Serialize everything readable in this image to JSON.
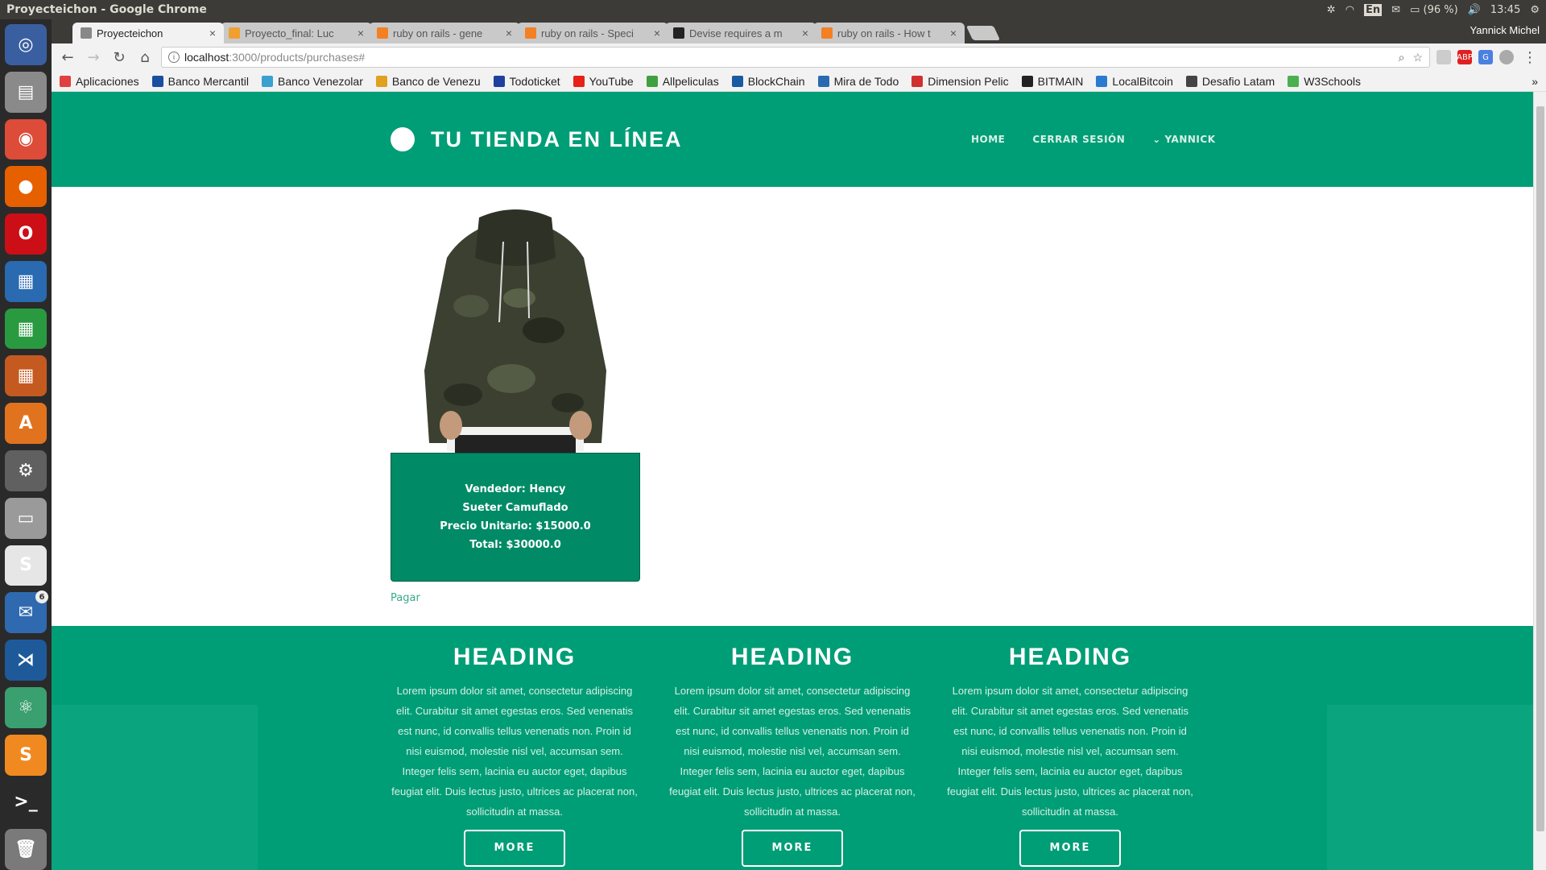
{
  "os": {
    "window_title": "Proyecteichon - Google Chrome",
    "battery": "(96 %)",
    "time": "13:45",
    "keyboard": "En"
  },
  "browser": {
    "profile": "Yannick Michel",
    "tabs": [
      {
        "label": "Proyecteichon",
        "color": "#888888"
      },
      {
        "label": "Proyecto_final: Luc",
        "color": "#f0a030"
      },
      {
        "label": "ruby on rails - gene",
        "color": "#f48024"
      },
      {
        "label": "ruby on rails - Speci",
        "color": "#f48024"
      },
      {
        "label": "Devise requires a m",
        "color": "#222222"
      },
      {
        "label": "ruby on rails - How t",
        "color": "#f48024"
      }
    ],
    "url_host": "localhost",
    "url_path": ":3000/products/purchases#",
    "bookmarks": [
      {
        "label": "Aplicaciones",
        "color": "#e04040"
      },
      {
        "label": "Banco Mercantil",
        "color": "#1a4fa0"
      },
      {
        "label": "Banco Venezolar",
        "color": "#3aa0d0"
      },
      {
        "label": "Banco de Venezu",
        "color": "#e0a020"
      },
      {
        "label": "Todoticket",
        "color": "#2040a0"
      },
      {
        "label": "YouTube",
        "color": "#e62117"
      },
      {
        "label": "Allpeliculas",
        "color": "#40a040"
      },
      {
        "label": "BlockChain",
        "color": "#1a5aa0"
      },
      {
        "label": "Mira de Todo",
        "color": "#2a6ab0"
      },
      {
        "label": "Dimension Pelic",
        "color": "#d03030"
      },
      {
        "label": "BITMAIN",
        "color": "#222222"
      },
      {
        "label": "LocalBitcoin",
        "color": "#2a7ad0"
      },
      {
        "label": "Desafio Latam",
        "color": "#444444"
      },
      {
        "label": "W3Schools",
        "color": "#4caf50"
      }
    ]
  },
  "site": {
    "brand": "TU TIENDA EN LÍNEA",
    "nav": {
      "home": "HOME",
      "logout": "CERRAR SESIÓN",
      "user": "⌄ YANNICK"
    },
    "product": {
      "seller": "Vendedor: Hency",
      "name": "Sueter Camuflado",
      "unit_price": "Precio Unitario: $15000.0",
      "total": "Total: $30000.0"
    },
    "pay_link": "Pagar",
    "features": [
      {
        "heading": "HEADING",
        "text": "Lorem ipsum dolor sit amet, consectetur adipiscing elit. Curabitur sit amet egestas eros. Sed venenatis est nunc, id convallis tellus venenatis non. Proin id nisi euismod, molestie nisl vel, accumsan sem. Integer felis sem, lacinia eu auctor eget, dapibus feugiat elit. Duis lectus justo, ultrices ac placerat non, sollicitudin at massa.",
        "button": "MORE"
      },
      {
        "heading": "HEADING",
        "text": "Lorem ipsum dolor sit amet, consectetur adipiscing elit. Curabitur sit amet egestas eros. Sed venenatis est nunc, id convallis tellus venenatis non. Proin id nisi euismod, molestie nisl vel, accumsan sem. Integer felis sem, lacinia eu auctor eget, dapibus feugiat elit. Duis lectus justo, ultrices ac placerat non, sollicitudin at massa.",
        "button": "MORE"
      },
      {
        "heading": "HEADING",
        "text": "Lorem ipsum dolor sit amet, consectetur adipiscing elit. Curabitur sit amet egestas eros. Sed venenatis est nunc, id convallis tellus venenatis non. Proin id nisi euismod, molestie nisl vel, accumsan sem. Integer felis sem, lacinia eu auctor eget, dapibus feugiat elit. Duis lectus justo, ultrices ac placerat non, sollicitudin at massa.",
        "button": "MORE"
      }
    ]
  },
  "launcher": [
    {
      "name": "ubuntu-dash-icon",
      "color": "#3a5fa0",
      "glyph": "◎"
    },
    {
      "name": "files-icon",
      "color": "#8a8a8a",
      "glyph": "▤"
    },
    {
      "name": "chrome-icon",
      "color": "#dd4b39",
      "glyph": "◉"
    },
    {
      "name": "firefox-icon",
      "color": "#e66000",
      "glyph": "●"
    },
    {
      "name": "opera-icon",
      "color": "#cc0f16",
      "glyph": "O"
    },
    {
      "name": "writer-icon",
      "color": "#2a6ab0",
      "glyph": "▦"
    },
    {
      "name": "calc-icon",
      "color": "#2a9a40",
      "glyph": "▦"
    },
    {
      "name": "impress-icon",
      "color": "#c45a20",
      "glyph": "▦"
    },
    {
      "name": "software-center-icon",
      "color": "#e2731e",
      "glyph": "A"
    },
    {
      "name": "settings-icon",
      "color": "#606060",
      "glyph": "⚙"
    },
    {
      "name": "disk-icon",
      "color": "#9a9a9a",
      "glyph": "▭"
    },
    {
      "name": "slack-icon",
      "color": "#e6e6e6",
      "glyph": "S"
    },
    {
      "name": "thunderbird-icon",
      "color": "#2f6ab0",
      "glyph": "✉",
      "badge": "6"
    },
    {
      "name": "vscode-icon",
      "color": "#1e5a9a",
      "glyph": "⋊"
    },
    {
      "name": "atom-icon",
      "color": "#3aa070",
      "glyph": "⚛"
    },
    {
      "name": "sublime-icon",
      "color": "#f08a20",
      "glyph": "S"
    },
    {
      "name": "terminal-icon",
      "color": "#2a2a2a",
      "glyph": ">_"
    },
    {
      "name": "trash-icon",
      "color": "#7a7a7a",
      "glyph": "🗑"
    }
  ]
}
